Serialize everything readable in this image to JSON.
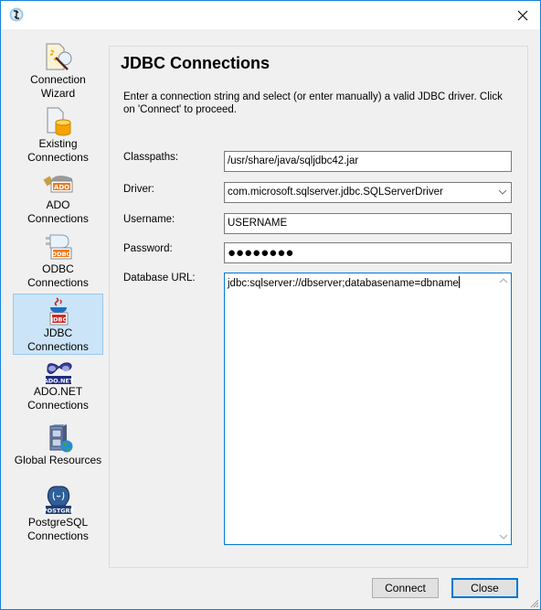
{
  "window": {
    "title": "",
    "close_label": "✕"
  },
  "sidebar": {
    "items": [
      {
        "line1": "Connection",
        "line2": "Wizard",
        "icon": "connection-wizard-icon",
        "active": false
      },
      {
        "line1": "Existing",
        "line2": "Connections",
        "icon": "existing-connections-icon",
        "active": false
      },
      {
        "line1": "ADO",
        "line2": "Connections",
        "icon": "ado-icon",
        "badge": "ADO",
        "active": false
      },
      {
        "line1": "ODBC",
        "line2": "Connections",
        "icon": "odbc-icon",
        "badge": "ODBC",
        "active": false
      },
      {
        "line1": "JDBC",
        "line2": "Connections",
        "icon": "jdbc-icon",
        "badge": "JDBC",
        "active": true
      },
      {
        "line1": "ADO.NET",
        "line2": "Connections",
        "icon": "adonet-icon",
        "badge": "ADO.NET",
        "active": false
      },
      {
        "line1": "Global Resources",
        "line2": "",
        "icon": "global-resources-icon",
        "active": false
      },
      {
        "line1": "PostgreSQL",
        "line2": "Connections",
        "icon": "postgresql-icon",
        "badge": "POSTGRE",
        "active": false
      }
    ]
  },
  "main": {
    "title": "JDBC Connections",
    "description": "Enter a connection string and select (or enter manually) a valid JDBC driver. Click on 'Connect' to proceed.",
    "fields": {
      "classpaths": {
        "label": "Classpaths:",
        "value": "/usr/share/java/sqljdbc42.jar"
      },
      "driver": {
        "label": "Driver:",
        "value": "com.microsoft.sqlserver.jdbc.SQLServerDriver"
      },
      "username": {
        "label": "Username:",
        "value": "USERNAME"
      },
      "password": {
        "label": "Password:",
        "masked_value": "●●●●●●●●"
      },
      "database_url": {
        "label": "Database URL:",
        "value": "jdbc:sqlserver://dbserver;databasename=dbname"
      }
    }
  },
  "buttons": {
    "connect": "Connect",
    "close": "Close"
  },
  "colors": {
    "accent": "#0078d7",
    "selection_bg": "#cce4f7",
    "selection_border": "#99c9ef"
  }
}
